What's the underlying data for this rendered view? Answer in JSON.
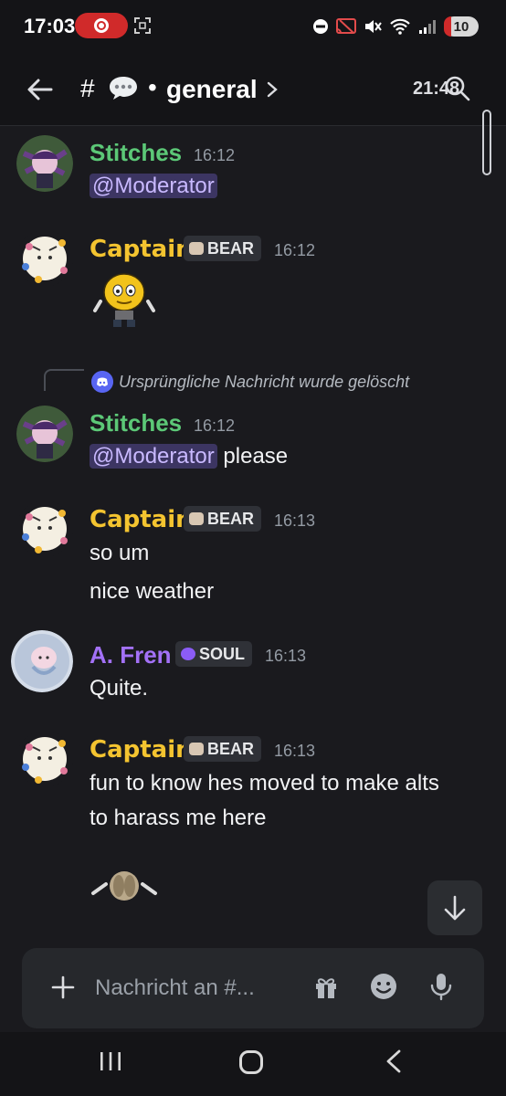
{
  "status_bar": {
    "time": "17:03",
    "battery": "10"
  },
  "header": {
    "hash": "#",
    "dot": "•",
    "channel_name": "general",
    "time": "21:48"
  },
  "messages": [
    {
      "id": "m1",
      "author": "Stitches",
      "time": "16:12",
      "mention": "@Moderator",
      "text": ""
    },
    {
      "id": "m2",
      "author": "Captain",
      "tag": "BEAR",
      "time": "16:12"
    },
    {
      "id": "m3",
      "reply_note": "Ursprüngliche Nachricht wurde gelöscht",
      "author": "Stitches",
      "time": "16:12",
      "mention": "@Moderator",
      "text": "please"
    },
    {
      "id": "m4",
      "author": "Captain",
      "tag": "BEAR",
      "time": "16:13",
      "lines": [
        "so um",
        "nice weather"
      ]
    },
    {
      "id": "m5",
      "author": "A. Fren",
      "tag": "SOUL",
      "time": "16:13",
      "text": "Quite."
    },
    {
      "id": "m6",
      "author": "Captain",
      "tag": "BEAR",
      "time": "16:13",
      "lines": [
        "fun to know hes moved to make alts",
        "to harass me here"
      ]
    }
  ],
  "composer": {
    "placeholder": "Nachricht an #..."
  },
  "colors": {
    "background": "#1a1a1e",
    "stitches": "#5cc877",
    "captain": "#f4c430",
    "fren": "#a371f7",
    "mention_bg": "#3c3562"
  }
}
